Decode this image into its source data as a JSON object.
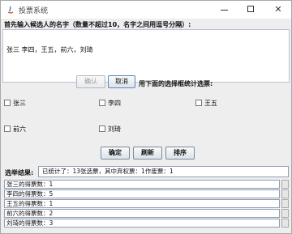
{
  "window": {
    "title": "投票系统",
    "controls": {
      "minimize": "minimize",
      "maximize": "maximize",
      "close": "✕"
    }
  },
  "input": {
    "prompt": "首先输入候选人的名字（数量不超过10，名字之间用逗号分隔）:",
    "value": "张三 李四，王五，前六，刘琦"
  },
  "buttons": {
    "confirm": "确认",
    "cancel": "取消",
    "ok": "确定",
    "refresh": "刷新",
    "sort": "排序"
  },
  "hint": "用下面的选择框统计选票:",
  "candidates": [
    {
      "name": "张三",
      "checked": false
    },
    {
      "name": "李四",
      "checked": false
    },
    {
      "name": "王五",
      "checked": false
    },
    {
      "name": "前六",
      "checked": false
    },
    {
      "name": "刘琦",
      "checked": false
    }
  ],
  "result": {
    "label": "选举结果:",
    "value": "已统计了：13张选票，其中弃权票：1作废票：1"
  },
  "tallies": [
    "张三的得票数：1",
    "李四的得票数：5",
    "王五的得票数：1",
    "前六的得票数：2",
    "刘琦的得票数：3"
  ]
}
